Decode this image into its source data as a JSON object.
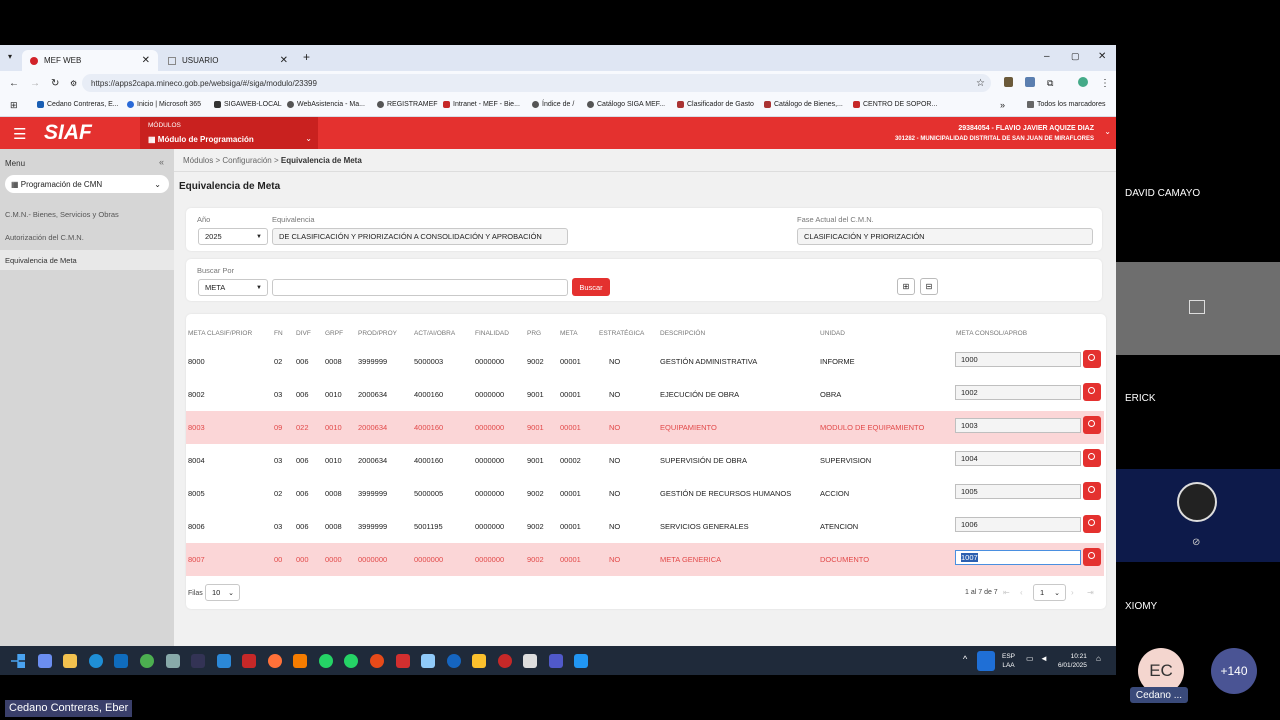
{
  "browser": {
    "tabs": [
      {
        "label": "MEF WEB"
      },
      {
        "label": "USUARIO"
      }
    ],
    "url": "https://apps2capa.mineco.gob.pe/websiga/#/siga/modulo/23399",
    "bookmarks": [
      "Cedano Contreras, E...",
      "Inicio | Microsoft 365",
      "SIGAWEB-LOCAL",
      "WebAsistencia - Ma...",
      "REGISTRAMEF",
      "Intranet - MEF - Bie...",
      "Índice de /",
      "Catálogo SIGA MEF...",
      "Clasificador de Gasto",
      "Catálogo de Bienes,...",
      "CENTRO DE SOPOR..."
    ],
    "all_bookmarks": "Todos los marcadores"
  },
  "header": {
    "logo": "SIAF",
    "modules_label": "MÓDULOS",
    "module": "Módulo de Programación",
    "user": "29384054 - FLAVIO JAVIER AQUIZE DIAZ",
    "entity": "301282 - MUNICIPALIDAD DISTRITAL DE SAN JUAN DE MIRAFLORES"
  },
  "sidebar": {
    "title": "Menu",
    "selected": "Programación de CMN",
    "items": [
      "C.M.N.- Bienes, Servicios y Obras",
      "Autorización del C.M.N.",
      "Equivalencia de Meta"
    ]
  },
  "breadcrumb": {
    "a": "Módulos",
    "b": "Configuración",
    "c": "Equivalencia de Meta"
  },
  "page_title": "Equivalencia de Meta",
  "filters": {
    "year_label": "Año",
    "year": "2025",
    "equiv_label": "Equivalencia",
    "equiv": "DE CLASIFICACIÓN Y PRIORIZACIÓN A CONSOLIDACIÓN Y APROBACIÓN",
    "phase_label": "Fase Actual del C.M.N.",
    "phase": "CLASIFICACIÓN Y PRIORIZACIÓN",
    "search_label": "Buscar Por",
    "search_by": "META",
    "search_value": "",
    "search_button": "Buscar"
  },
  "table": {
    "headers": [
      "META CLASIF/PRIOR",
      "FN",
      "DIVF",
      "GRPF",
      "PROD/PROY",
      "ACT/AI/OBRA",
      "FINALIDAD",
      "PRG",
      "META",
      "ESTRATÉGICA",
      "DESCRIPCIÓN",
      "UNIDAD",
      "META CONSOL/APROB"
    ],
    "rows": [
      [
        "8000",
        "02",
        "006",
        "0008",
        "3999999",
        "5000003",
        "0000000",
        "9002",
        "00001",
        "NO",
        "GESTIÓN ADMINISTRATIVA",
        "INFORME",
        "1000"
      ],
      [
        "8002",
        "03",
        "006",
        "0010",
        "2000634",
        "4000160",
        "0000000",
        "9001",
        "00001",
        "NO",
        "EJECUCIÓN DE OBRA",
        "OBRA",
        "1002"
      ],
      [
        "8003",
        "09",
        "022",
        "0010",
        "2000634",
        "4000160",
        "0000000",
        "9001",
        "00001",
        "NO",
        "EQUIPAMIENTO",
        "MODULO DE EQUIPAMIENTO",
        "1003"
      ],
      [
        "8004",
        "03",
        "006",
        "0010",
        "2000634",
        "4000160",
        "0000000",
        "9001",
        "00002",
        "NO",
        "SUPERVISIÓN DE OBRA",
        "SUPERVISION",
        "1004"
      ],
      [
        "8005",
        "02",
        "006",
        "0008",
        "3999999",
        "5000005",
        "0000000",
        "9002",
        "00001",
        "NO",
        "GESTIÓN DE RECURSOS HUMANOS",
        "ACCION",
        "1005"
      ],
      [
        "8006",
        "03",
        "006",
        "0008",
        "3999999",
        "5001195",
        "0000000",
        "9002",
        "00001",
        "NO",
        "SERVICIOS GENERALES",
        "ATENCION",
        "1006"
      ],
      [
        "8007",
        "00",
        "000",
        "0000",
        "0000000",
        "0000000",
        "0000000",
        "9002",
        "00001",
        "NO",
        "META GENERICA",
        "DOCUMENTO",
        "1007"
      ]
    ],
    "error_rows": [
      2,
      6
    ],
    "rows_label": "Filas",
    "rows_per_page": "10",
    "pagination": "1 al 7 de 7",
    "page": "1"
  },
  "taskbar": {
    "lang": "ESP",
    "lang2": "LAA",
    "time": "10:21",
    "date": "6/01/2025"
  },
  "participants": {
    "p1": "DAVID CAMAYO",
    "p2": "ERICK",
    "p3": "XIOMY",
    "initials": "EC",
    "short": "Cedano ...",
    "more": "+140",
    "speaker": "Cedano Contreras, Eber"
  },
  "colors": {
    "brand": "#e4312f",
    "error_row": "#fbd6d7"
  }
}
